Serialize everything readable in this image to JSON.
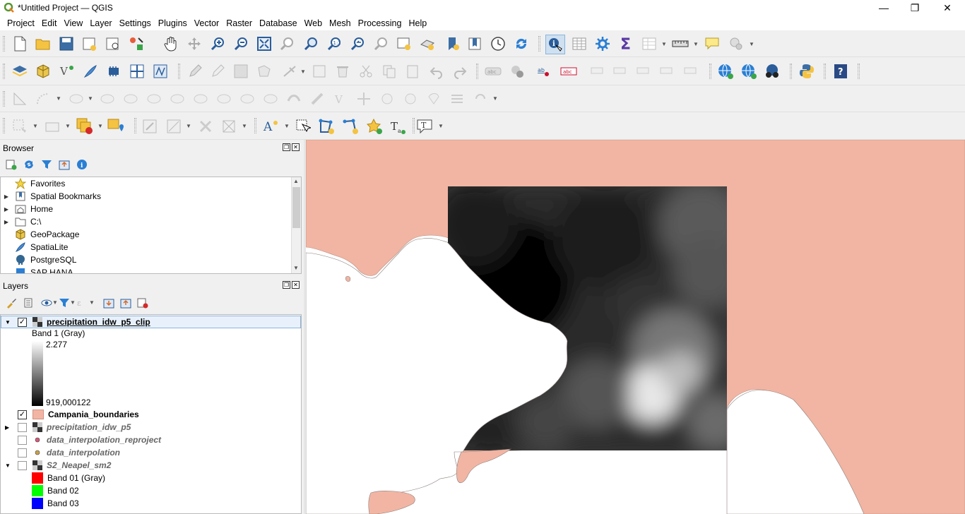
{
  "window": {
    "title": "*Untitled Project — QGIS"
  },
  "menu": [
    "Project",
    "Edit",
    "View",
    "Layer",
    "Settings",
    "Plugins",
    "Vector",
    "Raster",
    "Database",
    "Web",
    "Mesh",
    "Processing",
    "Help"
  ],
  "browser": {
    "title": "Browser",
    "items": [
      {
        "label": "Favorites",
        "icon": "star-icon",
        "arrow": false
      },
      {
        "label": "Spatial Bookmarks",
        "icon": "bookmark-icon",
        "arrow": true
      },
      {
        "label": "Home",
        "icon": "home-folder-icon",
        "arrow": true
      },
      {
        "label": "C:\\",
        "icon": "folder-icon",
        "arrow": true
      },
      {
        "label": "GeoPackage",
        "icon": "geopackage-icon",
        "arrow": false
      },
      {
        "label": "SpatiaLite",
        "icon": "spatialite-icon",
        "arrow": false
      },
      {
        "label": "PostgreSQL",
        "icon": "postgresql-icon",
        "arrow": false
      },
      {
        "label": "SAP HANA",
        "icon": "database-icon",
        "arrow": false
      }
    ]
  },
  "layers": {
    "title": "Layers",
    "items": [
      {
        "name": "precipitation_idw_p5_clip",
        "checked": true,
        "visible_style": "active"
      },
      {
        "name": "Campania_boundaries",
        "checked": true,
        "visible_style": "bold"
      },
      {
        "name": "precipitation_idw_p5",
        "checked": false,
        "visible_style": "disabled"
      },
      {
        "name": "data_interpolation_reproject",
        "checked": false,
        "visible_style": "disabled"
      },
      {
        "name": "data_interpolation",
        "checked": false,
        "visible_style": "disabled"
      },
      {
        "name": "S2_Neapel_sm2",
        "checked": false,
        "visible_style": "disabled"
      }
    ],
    "legend": {
      "band_label": "Band 1 (Gray)",
      "max_value": "2.277",
      "min_value": "919,000122"
    },
    "s2_bands": [
      {
        "label": "Band 01 (Gray)",
        "color": "#ff0000"
      },
      {
        "label": "Band 02",
        "color": "#00ff00"
      },
      {
        "label": "Band 03",
        "color": "#0000ff"
      }
    ]
  },
  "colors": {
    "boundary_fill": "#f2b5a3",
    "selection": "#cfe0f0",
    "panel_bg": "#f0f0f0"
  }
}
